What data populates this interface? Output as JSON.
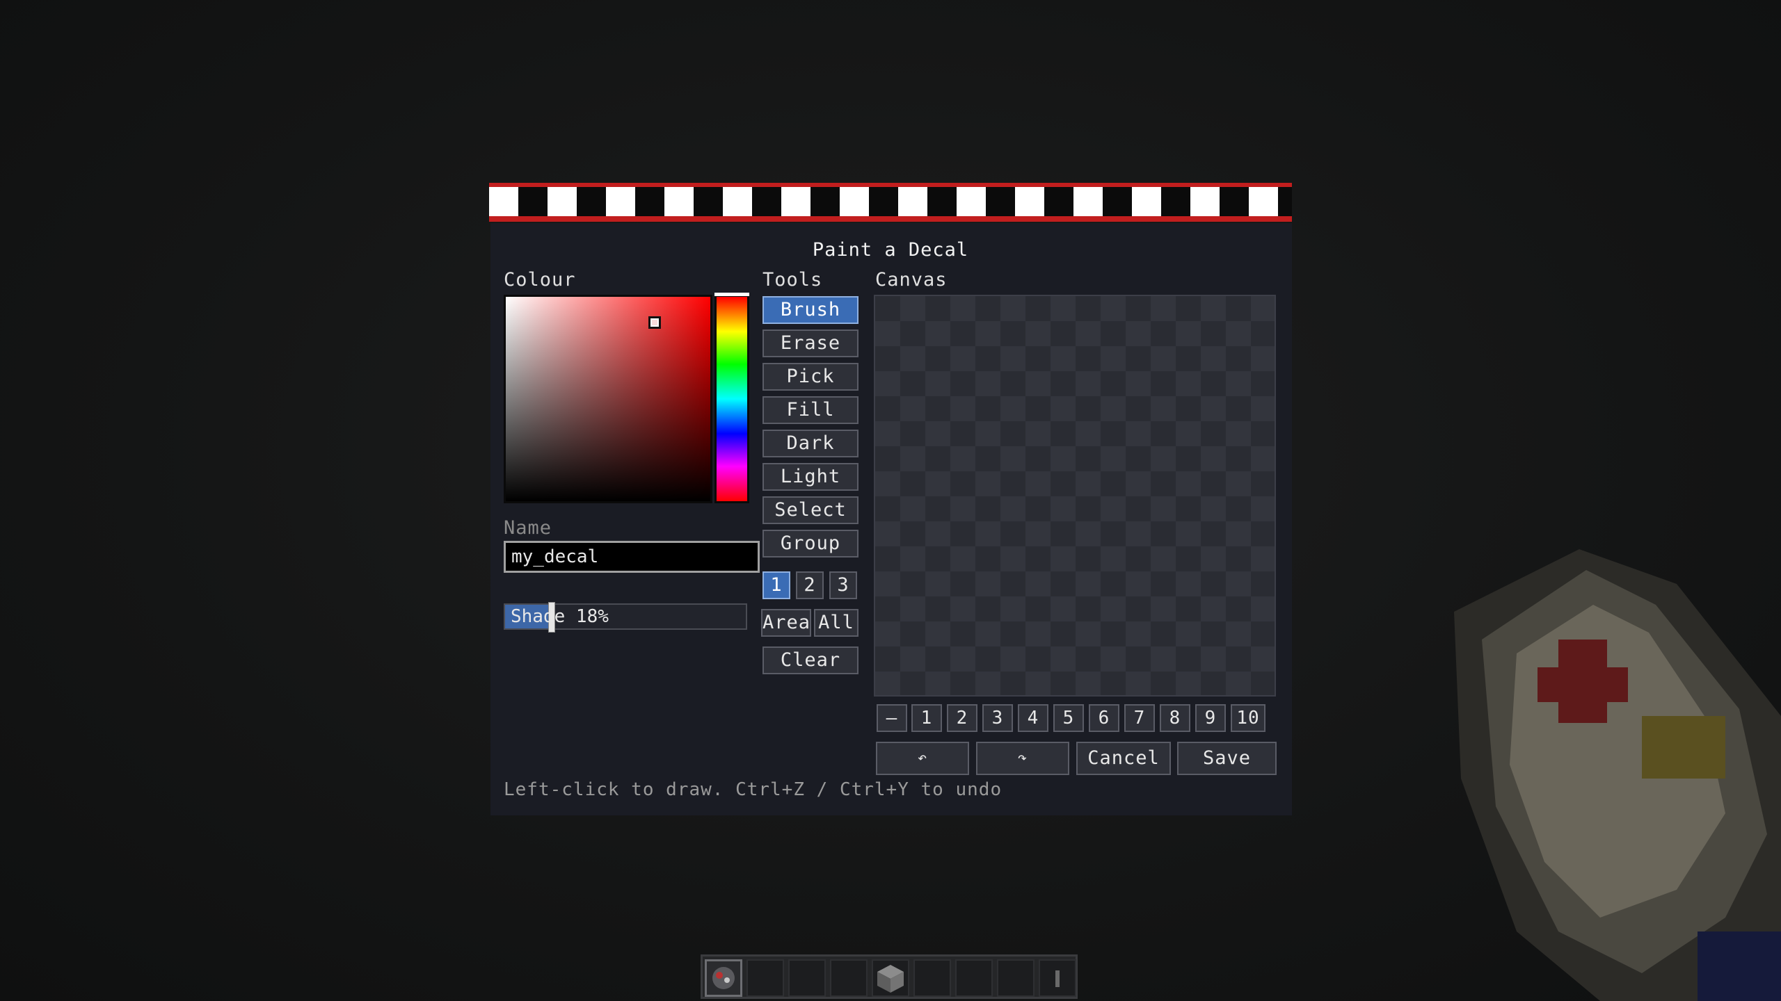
{
  "dialog": {
    "title": "Paint a Decal",
    "hint": "Left-click to draw. Ctrl+Z / Ctrl+Y to undo"
  },
  "colour": {
    "label": "Colour",
    "current_hex": "#e23c3c",
    "hue_marker_color": "#ffffff"
  },
  "name": {
    "label": "Name",
    "value": "my_decal"
  },
  "shade": {
    "text": "Shade 18%",
    "value": 18
  },
  "tools": {
    "label": "Tools",
    "items": [
      "Brush",
      "Erase",
      "Pick",
      "Fill",
      "Dark",
      "Light",
      "Select",
      "Group"
    ],
    "active": "Brush",
    "layers": [
      "1",
      "2",
      "3"
    ],
    "active_layer": "1",
    "area_label": "Area",
    "all_label": "All",
    "clear_label": "Clear"
  },
  "canvas": {
    "label": "Canvas",
    "zoom_buttons": [
      "–",
      "1",
      "2",
      "3",
      "4",
      "5",
      "6",
      "7",
      "8",
      "9",
      "10"
    ]
  },
  "actions": {
    "undo_icon": "undo-icon",
    "redo_icon": "redo-icon",
    "undo_glyph": "↶",
    "redo_glyph": "↷",
    "cancel_label": "Cancel",
    "save_label": "Save"
  },
  "colors": {
    "accent": "#3a6cb5",
    "banner_red": "#c21e1e",
    "panel_bg": "#1a1c24"
  },
  "hotbar": {
    "slots": 9,
    "selected": 0
  }
}
